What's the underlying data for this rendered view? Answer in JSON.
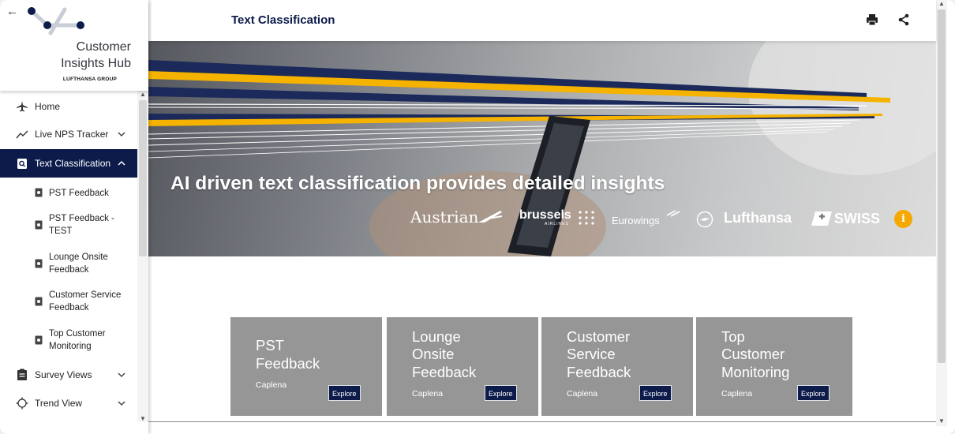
{
  "logo": {
    "line1": "Customer",
    "line2": "Insights Hub",
    "group": "LUFTHANSA GROUP"
  },
  "header": {
    "title": "Text Classification"
  },
  "nav": {
    "items": [
      {
        "label": "Home",
        "icon": "airplane-icon"
      },
      {
        "label": "Live NPS Tracker",
        "icon": "trend-line-icon"
      },
      {
        "label": "Text Classification",
        "icon": "document-search-icon"
      },
      {
        "label": "Survey Views",
        "icon": "clipboard-icon"
      },
      {
        "label": "Trend View",
        "icon": "crosshair-icon"
      }
    ],
    "sub_items": [
      {
        "line1": "PST Feedback",
        "line2": ""
      },
      {
        "line1": "PST Feedback -",
        "line2": "TEST"
      },
      {
        "line1": "Lounge Onsite",
        "line2": "Feedback"
      },
      {
        "line1": "Customer Service",
        "line2": "Feedback"
      },
      {
        "line1": "Top Customer",
        "line2": "Monitoring"
      }
    ]
  },
  "banner": {
    "headline": "AI driven text classification provides detailed insights",
    "brands": {
      "austrian": "Austrian",
      "brussels": "brussels",
      "brussels_sub": "AIRLINES",
      "eurowings": "Eurowings",
      "lufthansa": "Lufthansa",
      "swiss": "SWISS"
    },
    "info": "i"
  },
  "cards": [
    {
      "line1": "PST",
      "line2": "Feedback",
      "line3": "",
      "provider": "Caplena",
      "button": "Explore"
    },
    {
      "line1": "Lounge",
      "line2": "Onsite",
      "line3": "Feedback",
      "provider": "Caplena",
      "button": "Explore"
    },
    {
      "line1": "Customer",
      "line2": "Service",
      "line3": "Feedback",
      "provider": "Caplena",
      "button": "Explore"
    },
    {
      "line1": "Top",
      "line2": "Customer",
      "line3": "Monitoring",
      "provider": "Caplena",
      "button": "Explore"
    }
  ],
  "colors": {
    "navy": "#0c1b4a",
    "accent_yellow": "#f5a800",
    "card_gray": "#969696"
  }
}
